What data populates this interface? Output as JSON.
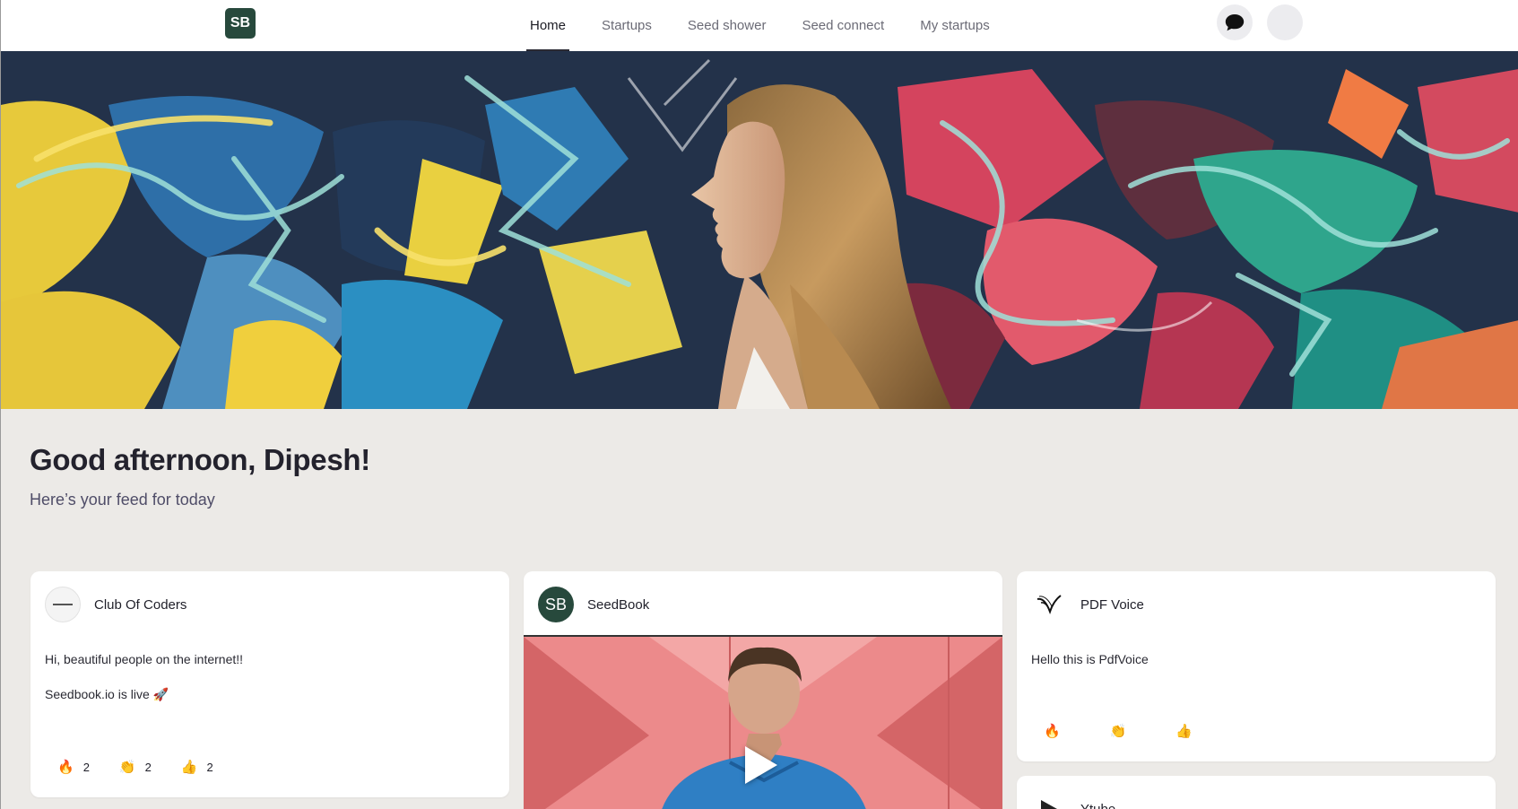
{
  "header": {
    "logo_text": "SB",
    "nav": [
      "Home",
      "Startups",
      "Seed shower",
      "Seed connect",
      "My startups"
    ],
    "active_nav": "Home"
  },
  "greeting": {
    "title": "Good afternoon, Dipesh!",
    "subtitle": "Here’s your feed for today"
  },
  "feed": [
    {
      "name": "Club Of Coders",
      "lines": [
        "Hi, beautiful people on the internet!!",
        "Seedbook.io is live 🚀"
      ],
      "reactions": [
        {
          "emoji": "🔥",
          "count": "2"
        },
        {
          "emoji": "👏",
          "count": "2"
        },
        {
          "emoji": "👍",
          "count": "2"
        }
      ]
    },
    {
      "name": "SeedBook",
      "avatar_text": "SB",
      "media": "video",
      "play_icon": "play-icon"
    },
    {
      "name": "PDF Voice",
      "lines": [
        "Hello this is PdfVoice"
      ],
      "reactions": [
        {
          "emoji": "🔥",
          "count": ""
        },
        {
          "emoji": "👏",
          "count": ""
        },
        {
          "emoji": "👍",
          "count": ""
        }
      ]
    },
    {
      "name": "Ytube"
    }
  ],
  "colors": {
    "background": "#eceae7",
    "brand": "#27493c",
    "nav_active": "#1c1c24",
    "nav_inactive": "#6b6b76"
  }
}
